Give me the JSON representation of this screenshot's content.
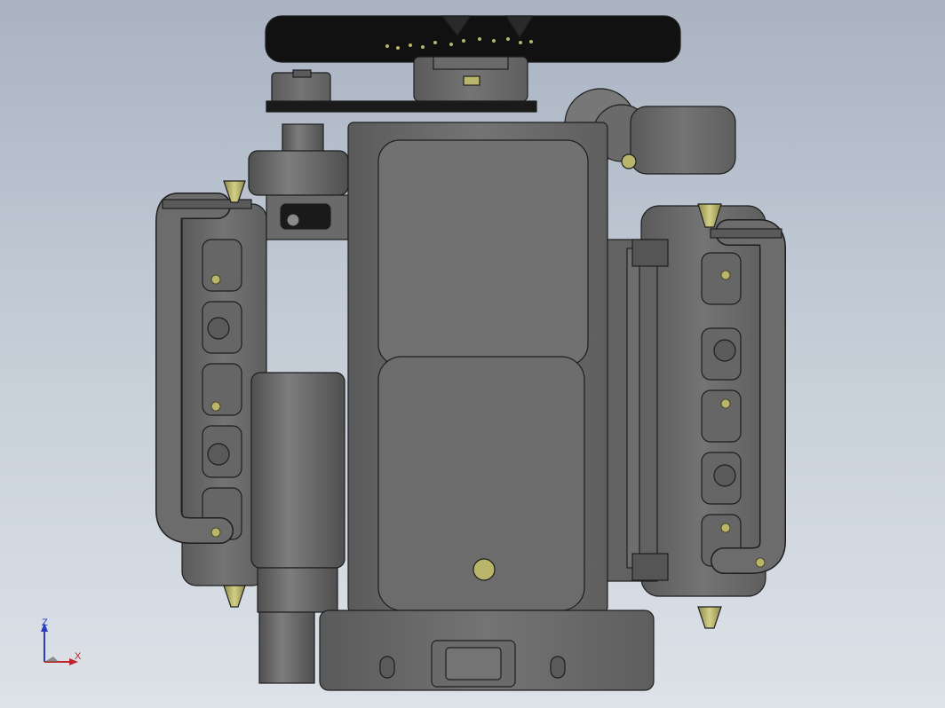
{
  "viewport": {
    "background_top": "#a9b3c2",
    "background_bottom": "#dde2e8"
  },
  "model": {
    "body_color": "#6e6e6e",
    "edge_color": "#1e1e1e",
    "fastener_color": "#b9b56a",
    "fan_color": "#111111"
  },
  "triad": {
    "z_label": "Z",
    "x_label": "X",
    "z_color": "#2a3dbf",
    "x_color": "#c0242a"
  }
}
